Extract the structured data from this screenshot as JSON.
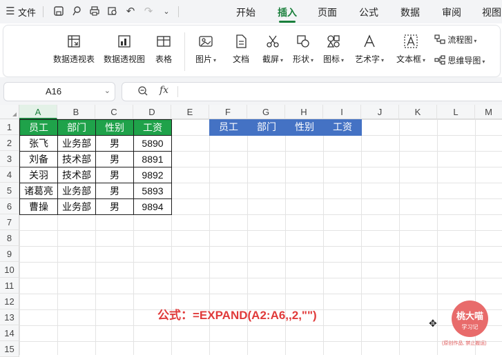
{
  "titlebar": {
    "file_label": "文件",
    "icons": [
      "menu-icon",
      "save-icon",
      "format-painter-icon",
      "print-icon",
      "print-preview-icon",
      "undo-icon",
      "redo-icon",
      "more-icon"
    ]
  },
  "tabs": [
    {
      "label": "开始",
      "active": false
    },
    {
      "label": "插入",
      "active": true
    },
    {
      "label": "页面",
      "active": false
    },
    {
      "label": "公式",
      "active": false
    },
    {
      "label": "数据",
      "active": false
    },
    {
      "label": "审阅",
      "active": false
    },
    {
      "label": "视图",
      "active": false
    }
  ],
  "ribbon": {
    "pivot_table": "数据透视表",
    "pivot_chart": "数据透视图",
    "table": "表格",
    "picture": "图片",
    "document": "文档",
    "screenshot": "截屏",
    "shape": "形状",
    "icon": "图标",
    "wordart": "艺术字",
    "textbox": "文本框",
    "flowchart": "流程图",
    "mindmap": "思维导图"
  },
  "formula_bar": {
    "name_box": "A16",
    "fx_label": "fx",
    "content": ""
  },
  "columns": [
    "A",
    "B",
    "C",
    "D",
    "E",
    "F",
    "G",
    "H",
    "I",
    "J",
    "K",
    "L",
    "M"
  ],
  "rows": [
    "1",
    "2",
    "3",
    "4",
    "5",
    "6",
    "7",
    "8",
    "9",
    "10",
    "11",
    "12",
    "13",
    "14",
    "15"
  ],
  "source_table": {
    "headers": [
      "员工",
      "部门",
      "性别",
      "工资"
    ],
    "rows": [
      [
        "张飞",
        "业务部",
        "男",
        "5890"
      ],
      [
        "刘备",
        "技术部",
        "男",
        "8891"
      ],
      [
        "关羽",
        "技术部",
        "男",
        "9892"
      ],
      [
        "诸葛亮",
        "业务部",
        "男",
        "5893"
      ],
      [
        "曹操",
        "业务部",
        "男",
        "9894"
      ]
    ]
  },
  "target_table": {
    "headers": [
      "员工",
      "部门",
      "性别",
      "工资"
    ]
  },
  "formula_note": "公式：=EXPAND(A2:A6,,2,\"\")",
  "watermark": {
    "name": "桃大喵",
    "subtitle": "学习记",
    "caption": "(原创作品, 禁止搬运)"
  },
  "colors": {
    "accent_green": "#1a7f3c",
    "header_green": "#1fa24a",
    "header_blue": "#4472c4",
    "note_red": "#e03a3a"
  }
}
